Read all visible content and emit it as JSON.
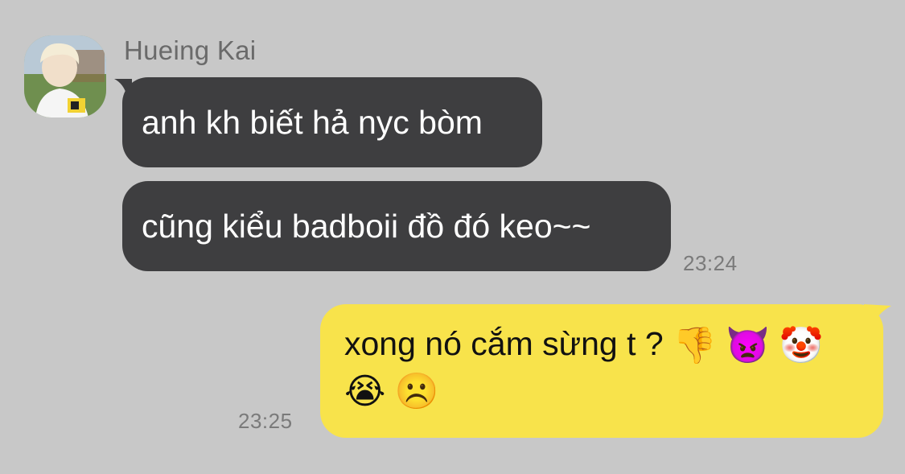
{
  "chat": {
    "sender_name": "Hueing Kai",
    "messages": [
      {
        "direction": "incoming",
        "text": "anh kh biết hả nyc bòm"
      },
      {
        "direction": "incoming",
        "text": "cũng kiểu badboii đồ đó keo~~",
        "time": "23:24"
      },
      {
        "direction": "outgoing",
        "text": "xong nó cắm sừng t ?",
        "emojis": [
          "👎",
          "👿",
          "🤡",
          "😭",
          "☹️"
        ],
        "emoji_names": [
          "thumbs-down-icon",
          "angry-devil-icon",
          "clown-face-icon",
          "loudly-crying-face-icon",
          "frowning-face-icon"
        ],
        "time": "23:25"
      }
    ]
  },
  "colors": {
    "background": "#c8c8c8",
    "incoming_bubble": "#3e3e40",
    "outgoing_bubble": "#f8e34b",
    "timestamp": "#7a7a7a",
    "sender_name": "#6a6a6a"
  }
}
